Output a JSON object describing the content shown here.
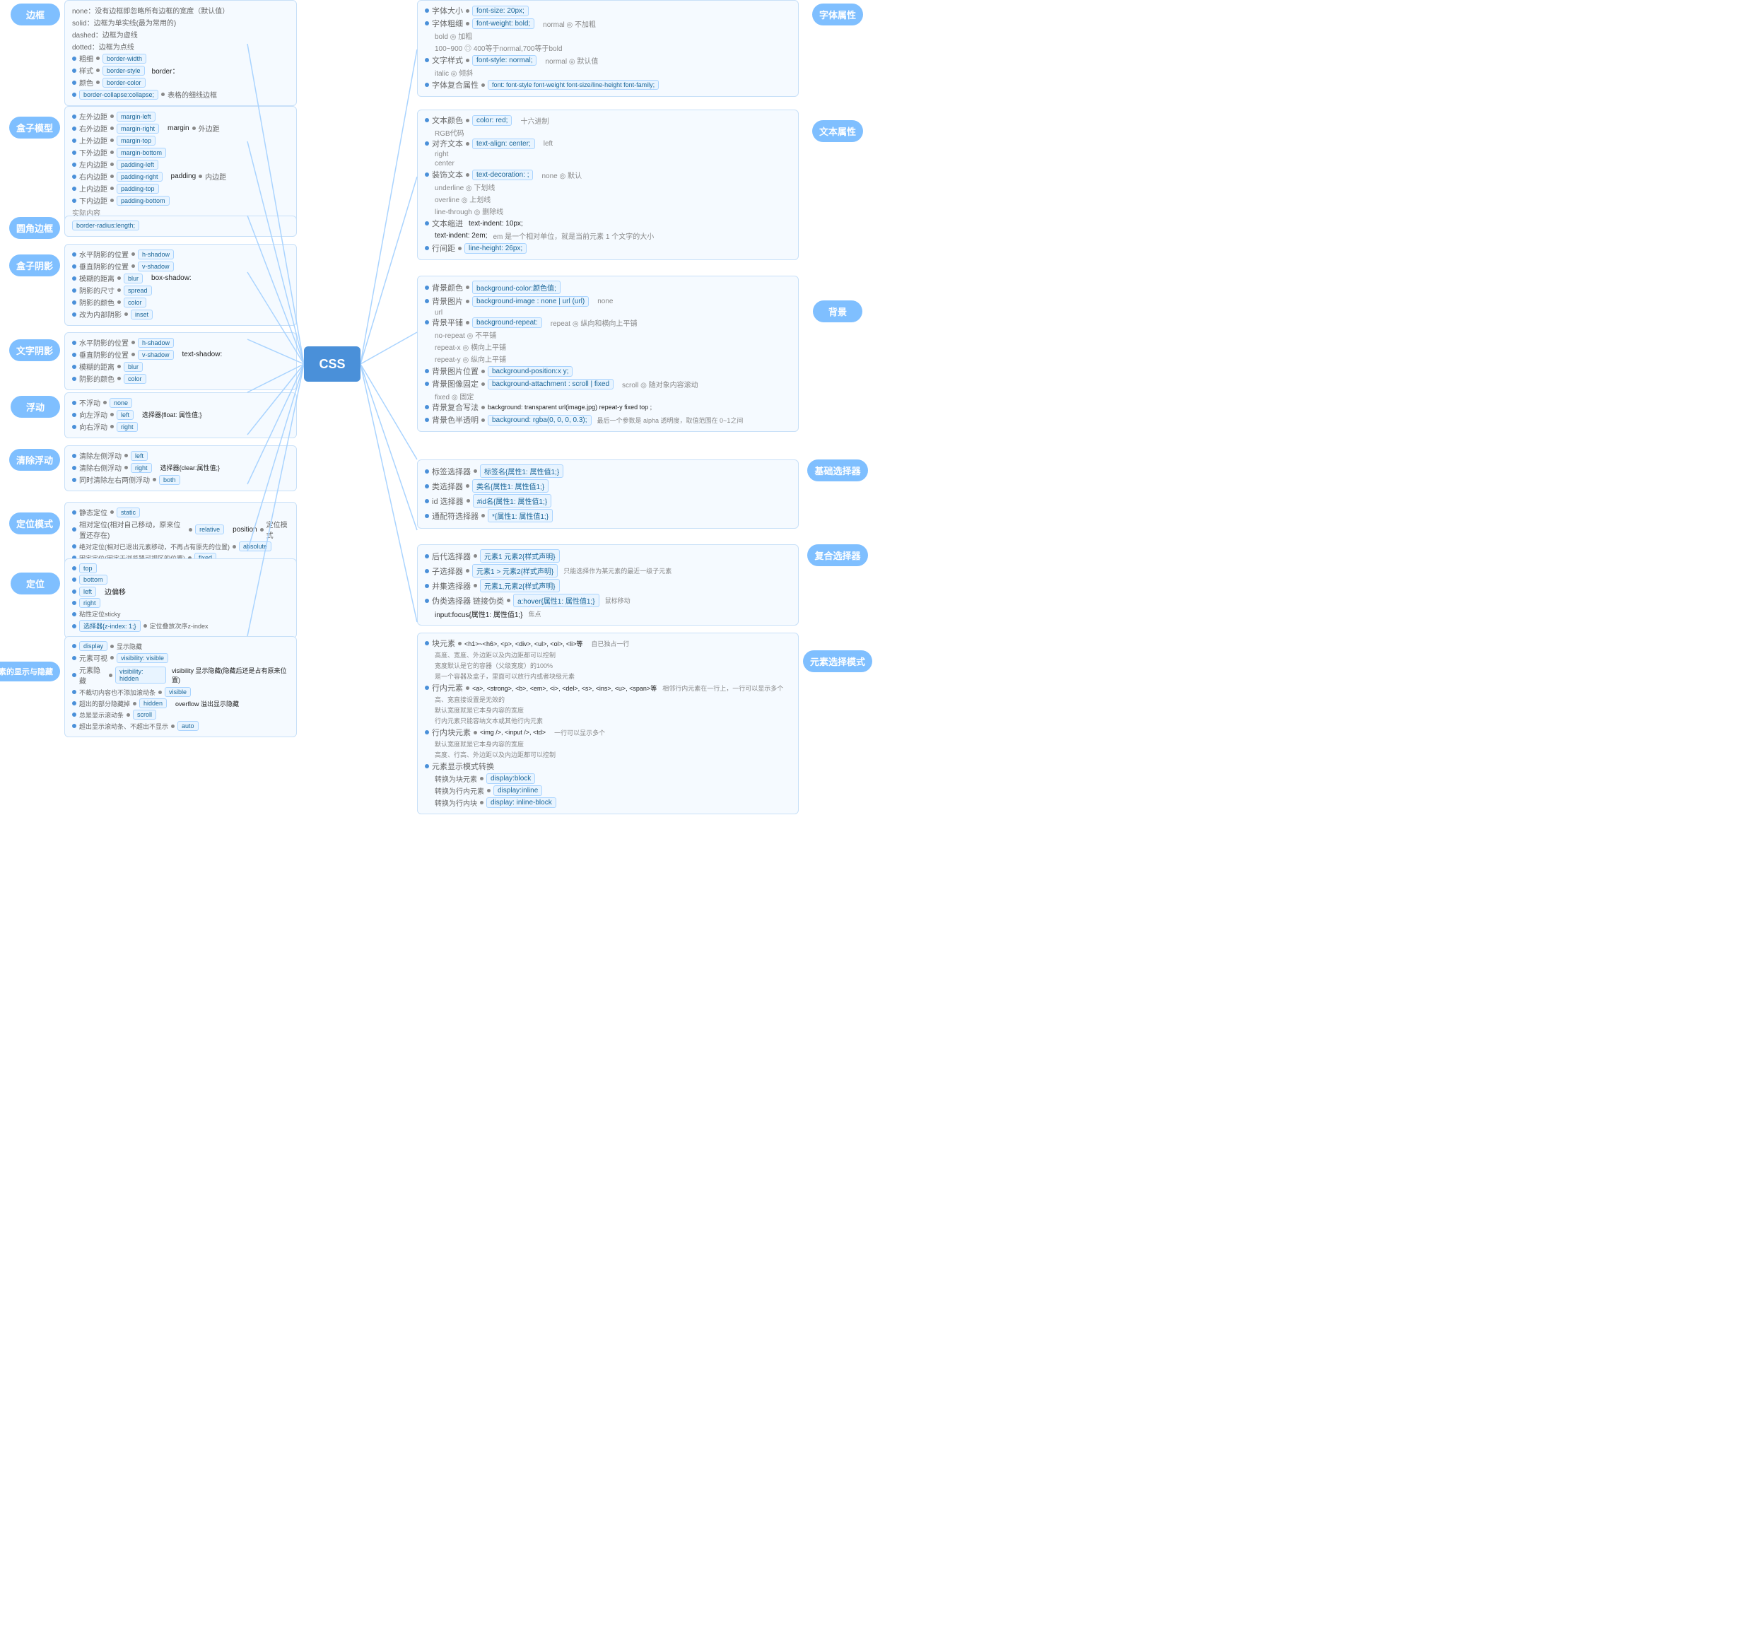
{
  "center": "CSS",
  "left_branches": [
    {
      "id": "border",
      "label": "边框",
      "items": [
        {
          "key": "border-width",
          "label": "粗细"
        },
        {
          "key": "border-style",
          "label": "样式"
        },
        {
          "key": "border-color",
          "label": "颜色"
        },
        {
          "key": "border:",
          "label": ""
        },
        {
          "values": [
            "none：没有边框即忽略所有边框的宽度（默认值）"
          ]
        },
        {
          "values": [
            "solid：边框为单实线(最为常用的)"
          ]
        },
        {
          "values": [
            "dashed：边框为虚线"
          ]
        },
        {
          "values": [
            "dotted：边框为点线"
          ]
        },
        {
          "key": "border-collapse:collapse;",
          "label": "表格的细线边框"
        }
      ]
    },
    {
      "id": "box-model",
      "label": "盒子模型",
      "items": [
        {
          "key": "margin-left",
          "label": "左外边距"
        },
        {
          "key": "margin-right",
          "label": "右外边距"
        },
        {
          "key": "margin-top",
          "label": "上外边距"
        },
        {
          "key": "margin-bottom",
          "label": "下外边距"
        },
        {
          "key": "margin",
          "label": "外边距"
        },
        {
          "key": "padding-left",
          "label": "左内边距"
        },
        {
          "key": "padding-right",
          "label": "右内边距"
        },
        {
          "key": "padding-top",
          "label": "上内边距"
        },
        {
          "key": "padding-bottom",
          "label": "下内边距"
        },
        {
          "key": "padding",
          "label": "内边距"
        },
        {
          "key": "",
          "label": "实际内容"
        }
      ]
    },
    {
      "id": "border-radius",
      "label": "圆角边框",
      "items": [
        {
          "key": "border-radius:length;",
          "label": ""
        }
      ]
    },
    {
      "id": "box-shadow",
      "label": "盒子阴影",
      "items": [
        {
          "key": "h-shadow",
          "label": "水平阴影的位置"
        },
        {
          "key": "v-shadow",
          "label": "垂直阴影的位置"
        },
        {
          "key": "blur",
          "label": "模糊的距离"
        },
        {
          "key": "spread",
          "label": "阴影的尺寸"
        },
        {
          "key": "color",
          "label": "阴影的颜色"
        },
        {
          "key": "inset",
          "label": "改为内部阴影"
        },
        {
          "key": "box-shadow:",
          "label": ""
        }
      ]
    },
    {
      "id": "text-shadow",
      "label": "文字阴影",
      "items": [
        {
          "key": "h-shadow",
          "label": "水平阴影的位置"
        },
        {
          "key": "v-shadow",
          "label": "垂直阴影的位置"
        },
        {
          "key": "blur",
          "label": "模糊的距离"
        },
        {
          "key": "color",
          "label": "阴影的颜色"
        },
        {
          "key": "text-shadow:",
          "label": ""
        }
      ]
    },
    {
      "id": "float",
      "label": "浮动",
      "items": [
        {
          "key": "none",
          "label": "不浮动"
        },
        {
          "key": "left",
          "label": "向左浮动"
        },
        {
          "key": "right",
          "label": "向右浮动"
        },
        {
          "key": "选择器{float: 属性值;}",
          "label": ""
        }
      ]
    },
    {
      "id": "clear-float",
      "label": "清除浮动",
      "items": [
        {
          "key": "left",
          "label": "清除左侧浮动"
        },
        {
          "key": "right",
          "label": "清除右侧浮动"
        },
        {
          "key": "both",
          "label": "同时清除左右两侧浮动"
        },
        {
          "key": "选择器{clear:属性值;}",
          "label": ""
        }
      ]
    },
    {
      "id": "position",
      "label": "定位模式",
      "items": [
        {
          "key": "static",
          "label": "静态定位"
        },
        {
          "key": "relative",
          "label": "相对定位(相对自己移动，原来位置还存在)"
        },
        {
          "key": "absolute",
          "label": "绝对定位(相对已退出元素移动，不再占有原先的位置)"
        },
        {
          "key": "fixed",
          "label": "固定定位(固定于浏览器可视区的位置)"
        },
        {
          "key": "position",
          "label": "定位模式"
        }
      ]
    },
    {
      "id": "position-props",
      "label": "定位",
      "items": [
        {
          "key": "top",
          "label": ""
        },
        {
          "key": "bottom",
          "label": ""
        },
        {
          "key": "left",
          "label": "边偏移"
        },
        {
          "key": "right",
          "label": ""
        },
        {
          "key": "sticky",
          "label": "粘性定位sticky"
        },
        {
          "key": "选择器{z-index: 1;}",
          "label": "定位叠放次序z-index"
        }
      ]
    },
    {
      "id": "display-hide",
      "label": "元素的显示与隐藏",
      "items": [
        {
          "key": "display",
          "label": "显示隐藏"
        },
        {
          "key": "visibility: visible",
          "label": "元素可视"
        },
        {
          "key": "visibility: hidden",
          "label": "元素隐藏"
        },
        {
          "key": "visibility",
          "label": "显示隐藏(隐藏后还是占有原来位置)"
        },
        {
          "key": "visible",
          "label": "不裁切内容也不添加滚动条"
        },
        {
          "key": "hidden",
          "label": "超出的部分隐藏掉"
        },
        {
          "key": "scroll",
          "label": "总是显示滚动条"
        },
        {
          "key": "auto",
          "label": "超出显示滚动条、不超出不显示"
        },
        {
          "key": "overflow",
          "label": "溢出显示隐藏"
        }
      ]
    }
  ],
  "right_branches": [
    {
      "id": "font",
      "label": "字体属性",
      "items": [
        {
          "key": "font-size: 20px;",
          "label": "字体大小"
        },
        {
          "key": "font-weight: bold;",
          "label": "字体粗细",
          "values": [
            "normal 不加粗",
            "bold 加粗",
            "100~900  400等于normal,700等于bold"
          ]
        },
        {
          "key": "font-style: normal;",
          "label": "文字样式",
          "values": [
            "normal 默认值",
            "italic 倾斜"
          ]
        },
        {
          "key": "font: font-style font-weight font-size/line-height font-family;",
          "label": "字体复合属性"
        }
      ]
    },
    {
      "id": "text",
      "label": "文本属性",
      "items": [
        {
          "key": "color: red;",
          "label": "文本颜色",
          "values": [
            "十六进制",
            "RGB代码"
          ]
        },
        {
          "key": "text-align: center;",
          "label": "对齐文本",
          "values": [
            "left",
            "right",
            "center"
          ]
        },
        {
          "key": "text-decoration: ;",
          "label": "装饰文本",
          "values": [
            "none 默认",
            "underline 下划线",
            "overline 上划线",
            "line-through 删除线"
          ]
        },
        {
          "key": "text-indent: 10px;",
          "label": "文本缩进"
        },
        {
          "key": "text-indent: 2em;",
          "label": "",
          "note": "em 是一个相对单位，就是当前元素 1 个文字的大小"
        },
        {
          "key": "line-height: 26px;",
          "label": "行间距"
        }
      ]
    },
    {
      "id": "background",
      "label": "背景",
      "items": [
        {
          "key": "background-color:颜色值;",
          "label": "背景颜色"
        },
        {
          "key": "background-image : none | url (url)",
          "label": "背景图片",
          "values": [
            "none",
            "url"
          ]
        },
        {
          "key": "background-repeat:",
          "label": "背景平铺",
          "values": [
            "repeat 纵向和横向上平铺",
            "no-repeat 不平铺",
            "repeat-x 横向上平铺",
            "repeat-y 纵向上平铺"
          ]
        },
        {
          "key": "background-position:x y;",
          "label": "背景图片位置"
        },
        {
          "key": "background-attachment : scroll | fixed",
          "label": "背景图像固定",
          "values": [
            "scroll 随对象内容滚动",
            "fixed 固定"
          ]
        },
        {
          "key": "background: transparent url(image.jpg) repeat-y fixed top ;",
          "label": "背景复合写法"
        },
        {
          "key": "background: rgba(0, 0, 0, 0.3);",
          "label": "背景色半透明",
          "note": "最后一个参数是 alpha 透明度，取值范围在 0~1之间"
        }
      ]
    },
    {
      "id": "basic-selector",
      "label": "基础选择器",
      "items": [
        {
          "key": "标签名{属性1: 属性值1;}",
          "label": "标签选择器"
        },
        {
          "key": "类名{属性1: 属性值1;}",
          "label": "类选择器"
        },
        {
          "key": "#id名{属性1: 属性值1;}",
          "label": "id 选择器"
        },
        {
          "key": "*{属性1: 属性值1;}",
          "label": "通配符选择器"
        }
      ]
    },
    {
      "id": "compound-selector",
      "label": "复合选择器",
      "items": [
        {
          "key": "元素1 元素2{样式声明}",
          "label": "后代选择器"
        },
        {
          "key": "元素1 > 元素2{样式声明}",
          "label": "子选择器",
          "note": "只能选择作为某元素的最近一级子元素"
        },
        {
          "key": "元素1,元素2{样式声明}",
          "label": "并集选择器"
        },
        {
          "key": "a:hover{属性1: 属性值1;}",
          "label": "伪类选择器 链接伪类",
          "note": "鼠标移动"
        },
        {
          "key": "input:focus{属性1: 属性值1;}",
          "label": "",
          "note": "焦点"
        }
      ]
    },
    {
      "id": "display-mode",
      "label": "元素选择模式",
      "items": [
        {
          "key": "<h1>~<h6>, <p>, <div>, <ul>, <ol>, <li>等",
          "label": "块元素",
          "features": [
            "自已独占一行",
            "高度、宽度、外边距以及内边距都可以控制",
            "宽度默认是它的容器（父级宽度）的100%",
            "是一个容器及盒子，里面可以放行内或者块级元素"
          ]
        },
        {
          "key": "<a>, <strong>, <b>, <em>, <i>, <del>, <s>, <ins>, <u>, <span>等",
          "label": "行内元素",
          "features": [
            "相邻行内元素在一行上，一行可以显示多个",
            "高、宽直接设置是无效的",
            "默认宽度就是它本身内容的宽度",
            "行内元素只能容纳文本或其他行内元素"
          ]
        },
        {
          "key": "<img />, <input />, <td>",
          "label": "行内块元素",
          "features": [
            "一行可以显示多个",
            "默认宽度就是它本身内容的宽度",
            "高度、行高、外边距以及内边距都可以控制"
          ]
        },
        {
          "key": "display:block",
          "label": "转换为块元素",
          "parent": "元素显示模式转换"
        },
        {
          "key": "display:inline",
          "label": "转换为行内元素",
          "parent": "元素显示模式转换"
        },
        {
          "key": "display: inline-block",
          "label": "转换为行内块",
          "parent": "元素显示模式转换"
        }
      ]
    }
  ]
}
